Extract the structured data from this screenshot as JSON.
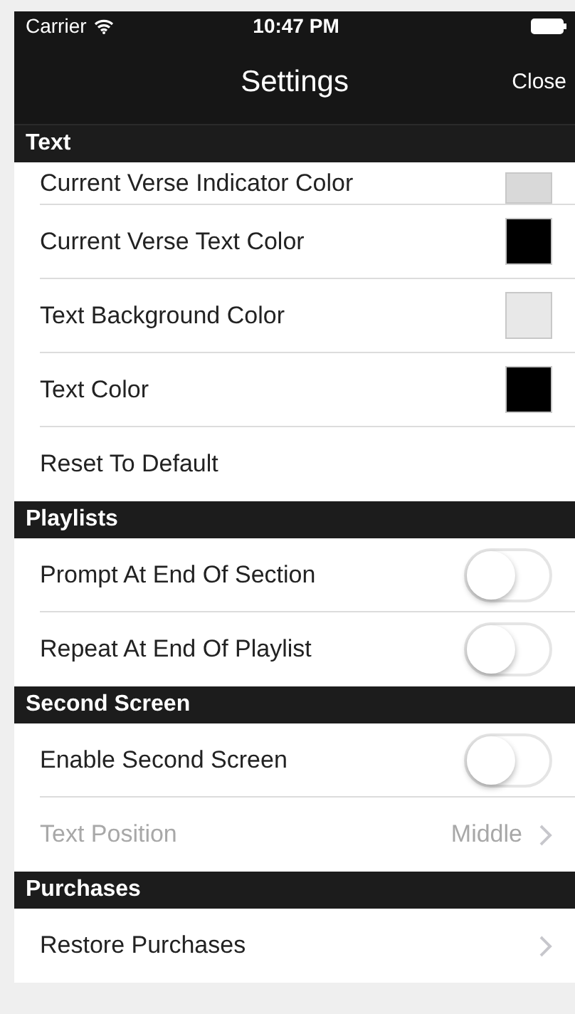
{
  "status_bar": {
    "carrier": "Carrier",
    "time": "10:47 PM"
  },
  "nav_bar": {
    "title": "Settings",
    "close_button": "Close"
  },
  "sections": [
    {
      "header": "Text",
      "rows": [
        {
          "kind": "swatch",
          "label": "Current Verse Indicator Color",
          "color": "#d9d9d9"
        },
        {
          "kind": "swatch",
          "label": "Current Verse Text Color",
          "color": "#000000"
        },
        {
          "kind": "swatch",
          "label": "Text Background Color",
          "color": "#e8e8e8"
        },
        {
          "kind": "swatch",
          "label": "Text Color",
          "color": "#000000"
        },
        {
          "kind": "action",
          "label": "Reset To Default"
        }
      ]
    },
    {
      "header": "Playlists",
      "rows": [
        {
          "kind": "toggle",
          "label": "Prompt At End Of Section",
          "on": false
        },
        {
          "kind": "toggle",
          "label": "Repeat At End Of Playlist",
          "on": false
        }
      ]
    },
    {
      "header": "Second Screen",
      "rows": [
        {
          "kind": "toggle",
          "label": "Enable Second Screen",
          "on": false
        },
        {
          "kind": "value",
          "label": "Text Position",
          "value": "Middle",
          "disabled": true
        }
      ]
    },
    {
      "header": "Purchases",
      "rows": [
        {
          "kind": "disclosure",
          "label": "Restore Purchases"
        }
      ]
    }
  ]
}
